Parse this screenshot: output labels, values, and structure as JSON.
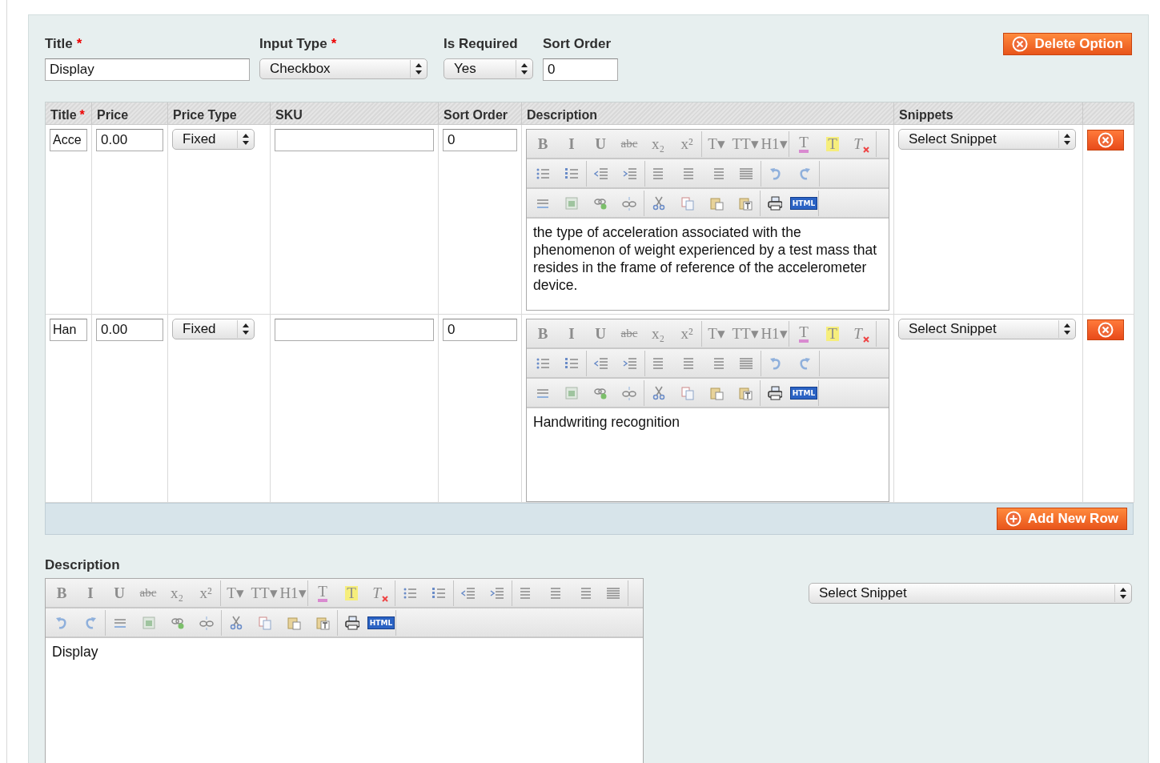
{
  "option": {
    "fields": [
      {
        "label": "Title",
        "required_mark": "*",
        "kind": "text",
        "value": "Display"
      },
      {
        "label": "Input Type",
        "required_mark": "*",
        "kind": "select",
        "value": "Checkbox"
      },
      {
        "label": "Is Required",
        "kind": "select",
        "value": "Yes"
      },
      {
        "label": "Sort Order",
        "kind": "text",
        "value": "0"
      }
    ],
    "delete_button": "Delete Option"
  },
  "table": {
    "columns": [
      {
        "label": "Title",
        "required_mark": "*"
      },
      {
        "label": "Price"
      },
      {
        "label": "Price Type"
      },
      {
        "label": "SKU"
      },
      {
        "label": "Sort Order"
      },
      {
        "label": "Description"
      },
      {
        "label": "Snippets"
      }
    ],
    "rows": [
      {
        "title": "Acce",
        "price": "0.00",
        "price_type": "Fixed",
        "sort_order": "0",
        "description": "the type of acceleration associated with the phenomenon of weight experienced by a test mass that resides in the frame of reference of the accelerometer device.",
        "snippet": "Select Snippet",
        "toolbar": [
          [
            [
              {
                "kind": "glyph",
                "label": "B"
              },
              {
                "kind": "glyph",
                "label": "I"
              },
              {
                "kind": "glyph",
                "label": "U"
              },
              {
                "kind": "strike",
                "label": "abc"
              },
              {
                "kind": "glyph",
                "label": "x₂"
              },
              {
                "kind": "glyph",
                "label": "x²"
              }
            ],
            [
              {
                "kind": "glyph",
                "label": "T▾"
              },
              {
                "kind": "glyph",
                "label": "TT▾"
              },
              {
                "kind": "glyph",
                "label": "H1▾"
              }
            ],
            [
              {
                "kind": "text-color",
                "label": "T"
              },
              {
                "kind": "highlight",
                "label": "T"
              },
              {
                "kind": "clear",
                "label": "T"
              }
            ]
          ],
          [
            [
              {
                "kind": "bullets"
              },
              {
                "kind": "numbers"
              }
            ],
            [
              {
                "kind": "outdent"
              },
              {
                "kind": "indent"
              }
            ],
            [
              {
                "kind": "align-left"
              },
              {
                "kind": "align-center"
              },
              {
                "kind": "align-right"
              },
              {
                "kind": "justify"
              }
            ],
            [
              {
                "kind": "undo"
              },
              {
                "kind": "redo"
              }
            ]
          ],
          [
            [
              {
                "kind": "rule"
              },
              {
                "kind": "image"
              },
              {
                "kind": "link"
              },
              {
                "kind": "unlink"
              }
            ],
            [
              {
                "kind": "cut"
              },
              {
                "kind": "copy"
              },
              {
                "kind": "paste"
              },
              {
                "kind": "paste-text"
              }
            ],
            [
              {
                "kind": "print"
              },
              {
                "kind": "html",
                "label": "HTML"
              }
            ]
          ]
        ]
      },
      {
        "title": "Han",
        "price": "0.00",
        "price_type": "Fixed",
        "sort_order": "0",
        "description": "Handwriting recognition",
        "snippet": "Select Snippet",
        "toolbar": [
          [
            [
              {
                "kind": "glyph",
                "label": "B"
              },
              {
                "kind": "glyph",
                "label": "I"
              },
              {
                "kind": "glyph",
                "label": "U"
              },
              {
                "kind": "strike",
                "label": "abc"
              },
              {
                "kind": "glyph",
                "label": "x₂"
              },
              {
                "kind": "glyph",
                "label": "x²"
              }
            ],
            [
              {
                "kind": "glyph",
                "label": "T▾"
              },
              {
                "kind": "glyph",
                "label": "TT▾"
              },
              {
                "kind": "glyph",
                "label": "H1▾"
              }
            ],
            [
              {
                "kind": "text-color",
                "label": "T"
              },
              {
                "kind": "highlight",
                "label": "T"
              },
              {
                "kind": "clear",
                "label": "T"
              }
            ]
          ],
          [
            [
              {
                "kind": "bullets"
              },
              {
                "kind": "numbers"
              }
            ],
            [
              {
                "kind": "outdent"
              },
              {
                "kind": "indent"
              }
            ],
            [
              {
                "kind": "align-left"
              },
              {
                "kind": "align-center"
              },
              {
                "kind": "align-right"
              },
              {
                "kind": "justify"
              }
            ],
            [
              {
                "kind": "undo"
              },
              {
                "kind": "redo"
              }
            ]
          ],
          [
            [
              {
                "kind": "rule"
              },
              {
                "kind": "image"
              },
              {
                "kind": "link"
              },
              {
                "kind": "unlink"
              }
            ],
            [
              {
                "kind": "cut"
              },
              {
                "kind": "copy"
              },
              {
                "kind": "paste"
              },
              {
                "kind": "paste-text"
              }
            ],
            [
              {
                "kind": "print"
              },
              {
                "kind": "html",
                "label": "HTML"
              }
            ]
          ]
        ]
      }
    ],
    "add_button": "Add New Row"
  },
  "description": {
    "label": "Description",
    "text": "Display",
    "snippet": "Select Snippet",
    "toolbar": [
      [
        [
          {
            "kind": "glyph",
            "label": "B"
          },
          {
            "kind": "glyph",
            "label": "I"
          },
          {
            "kind": "glyph",
            "label": "U"
          },
          {
            "kind": "strike",
            "label": "abc"
          },
          {
            "kind": "glyph",
            "label": "x₂"
          },
          {
            "kind": "glyph",
            "label": "x²"
          }
        ],
        [
          {
            "kind": "glyph",
            "label": "T▾"
          },
          {
            "kind": "glyph",
            "label": "TT▾"
          },
          {
            "kind": "glyph",
            "label": "H1▾"
          }
        ],
        [
          {
            "kind": "text-color",
            "label": "T"
          },
          {
            "kind": "highlight",
            "label": "T"
          },
          {
            "kind": "clear",
            "label": "T"
          }
        ],
        [
          {
            "kind": "bullets"
          },
          {
            "kind": "numbers"
          }
        ],
        [
          {
            "kind": "outdent"
          },
          {
            "kind": "indent"
          }
        ],
        [
          {
            "kind": "align-left"
          },
          {
            "kind": "align-center"
          },
          {
            "kind": "align-right"
          },
          {
            "kind": "justify"
          }
        ]
      ],
      [
        [
          {
            "kind": "undo"
          },
          {
            "kind": "redo"
          }
        ],
        [
          {
            "kind": "rule"
          },
          {
            "kind": "image"
          },
          {
            "kind": "link"
          },
          {
            "kind": "unlink"
          }
        ],
        [
          {
            "kind": "cut"
          },
          {
            "kind": "copy"
          },
          {
            "kind": "paste"
          },
          {
            "kind": "paste-text"
          }
        ],
        [
          {
            "kind": "print"
          },
          {
            "kind": "html",
            "label": "HTML"
          }
        ]
      ]
    ]
  }
}
